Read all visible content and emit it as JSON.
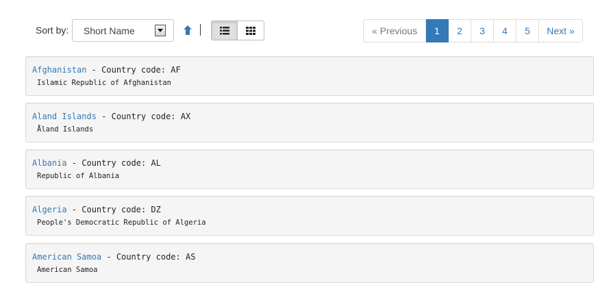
{
  "sort": {
    "label": "Sort by:",
    "selected": "Short Name",
    "direction_icon": "arrow-up-icon"
  },
  "view": {
    "list_icon": "list-view-icon",
    "grid_icon": "grid-view-icon",
    "active": "list"
  },
  "pagination": {
    "previous": "« Previous",
    "pages": [
      "1",
      "2",
      "3",
      "4",
      "5"
    ],
    "current": "1",
    "next": "Next »"
  },
  "countries": [
    {
      "name": "Afghanistan",
      "code_label": " - Country code: AF",
      "official": "Islamic Republic of Afghanistan"
    },
    {
      "name": "Aland Islands",
      "code_label": " - Country code: AX",
      "official": "Åland Islands"
    },
    {
      "name": "Albania",
      "code_label": " - Country code: AL",
      "official": "Republic of Albania"
    },
    {
      "name": "Algeria",
      "code_label": " - Country code: DZ",
      "official": "People's Democratic Republic of Algeria"
    },
    {
      "name": "American Samoa",
      "code_label": " - Country code: AS",
      "official": "American Samoa"
    }
  ],
  "colors": {
    "link": "#337ab7",
    "card_bg": "#f5f5f5",
    "active_page": "#337ab7"
  }
}
